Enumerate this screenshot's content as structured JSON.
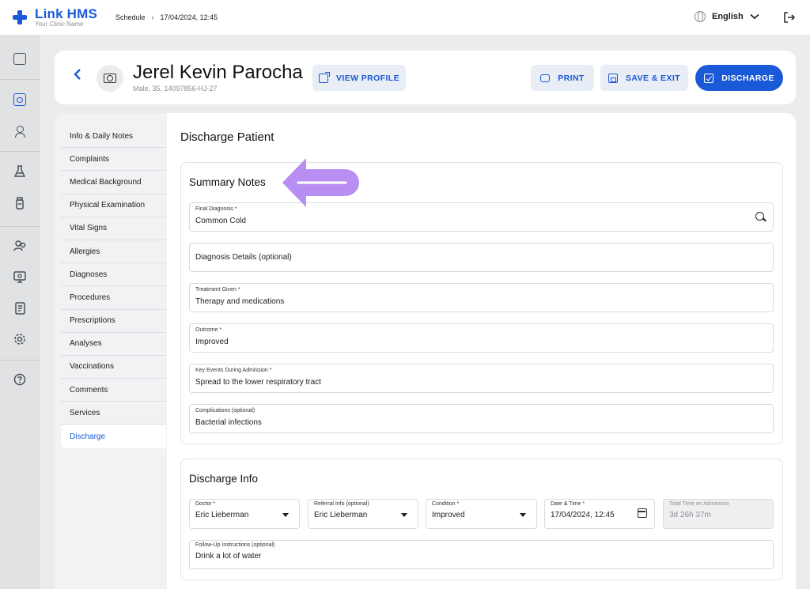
{
  "app": {
    "name": "Link HMS",
    "clinic": "Your Clinic Name"
  },
  "breadcrumb": {
    "first": "Schedule",
    "sep": "›",
    "current": "17/04/2024, 12:45"
  },
  "topbar": {
    "language": "English"
  },
  "patient": {
    "name": "Jerel Kevin Parocha",
    "meta": "Male, 35, 14097856-HJ-27"
  },
  "actions": {
    "view_profile": "VIEW PROFILE",
    "print": "PRINT",
    "save_exit": "SAVE & EXIT",
    "discharge": "DISCHARGE"
  },
  "nav": {
    "items": [
      "Info & Daily Notes",
      "Complaints",
      "Medical Background",
      "Physical Examination",
      "Vital Signs",
      "Allergies",
      "Diagnoses",
      "Procedures",
      "Prescriptions",
      "Analyses",
      "Vaccinations",
      "Comments",
      "Services",
      "Discharge"
    ],
    "active": "Discharge"
  },
  "page": {
    "title": "Discharge Patient"
  },
  "summary": {
    "title": "Summary Notes",
    "final_diagnosis": {
      "label": "Final Diagnosis *",
      "value": "Common Cold"
    },
    "diagnosis_details": {
      "placeholder": "Diagnosis Details (optional)"
    },
    "treatment": {
      "label": "Treatment Given *",
      "value": "Therapy and medications"
    },
    "outcome": {
      "label": "Outcome *",
      "value": "Improved"
    },
    "key_events": {
      "label": "Key Events During Admission *",
      "value": "Spread to the lower respiratory tract"
    },
    "complications": {
      "label": "Complications (optional)",
      "value": "Bacterial infections"
    }
  },
  "discharge_info": {
    "title": "Discharge Info",
    "doctor": {
      "label": "Doctor *",
      "value": "Eric Lieberman"
    },
    "referral": {
      "label": "Referral Info (optional)",
      "value": "Eric Lieberman"
    },
    "condition": {
      "label": "Condition *",
      "value": "Improved"
    },
    "datetime": {
      "label": "Date & Time *",
      "value": "17/04/2024, 12:45"
    },
    "total_time": {
      "label": "Total Time on Admission",
      "value": "3d 26h 37m"
    },
    "followup": {
      "label": "Follow-Up Instructions (optional)",
      "value": "Drink a lot of water"
    }
  },
  "colors": {
    "accent": "#1a5ad8",
    "annotation": "#b88ef2"
  },
  "icons": [
    "logo-cross-icon",
    "globe-icon",
    "chevron-down-icon",
    "logout-icon",
    "back-chevron-icon",
    "camera-plus-icon",
    "external-link-icon",
    "print-icon",
    "save-icon",
    "check-square-icon",
    "search-icon",
    "calendar-icon"
  ]
}
